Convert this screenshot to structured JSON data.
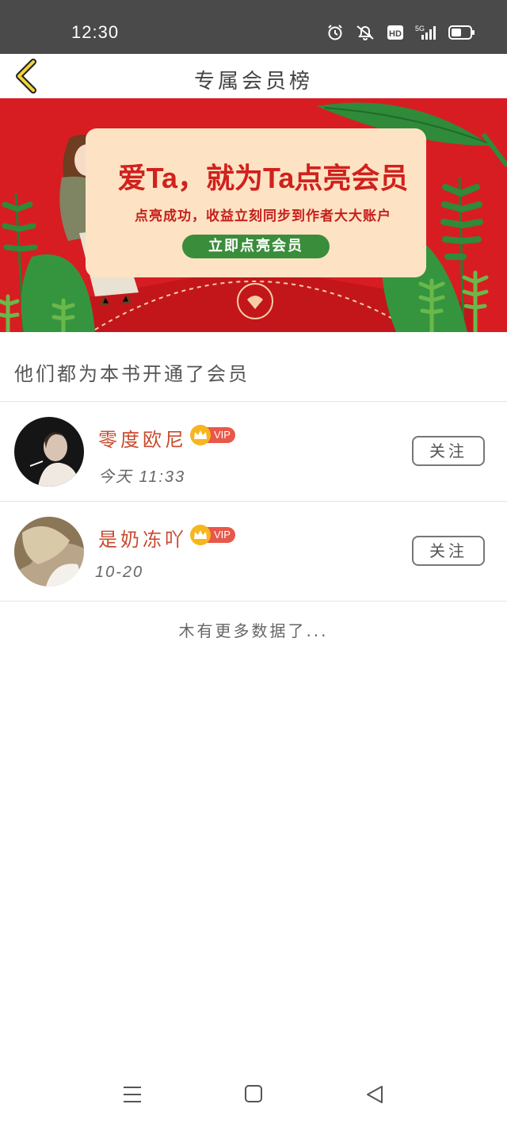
{
  "status_bar": {
    "time": "12:30",
    "icons": [
      "alarm-icon",
      "mute-icon",
      "hd-icon",
      "signal-5g-icon",
      "battery-icon"
    ],
    "hd_label": "HD",
    "network_label": "5G"
  },
  "header": {
    "title": "专属会员榜",
    "back_icon": "chevron-left-icon"
  },
  "banner": {
    "headline": "爱Ta，就为Ta点亮会员",
    "subline": "点亮成功，收益立刻同步到作者大大账户",
    "button_label": "立即点亮会员",
    "colors": {
      "background": "#d81d22",
      "card": "#fde3c4",
      "button": "#3a8d3b"
    }
  },
  "section": {
    "title": "他们都为本书开通了会员"
  },
  "members": [
    {
      "name": "零度欧尼",
      "badge": "VIP",
      "time": "今天 11:33",
      "follow_label": "关注"
    },
    {
      "name": "是奶冻吖",
      "badge": "VIP",
      "time": "10-20",
      "follow_label": "关注"
    }
  ],
  "footer": {
    "no_more": "木有更多数据了..."
  },
  "system_nav": [
    "menu-icon",
    "home-icon",
    "back-icon"
  ]
}
